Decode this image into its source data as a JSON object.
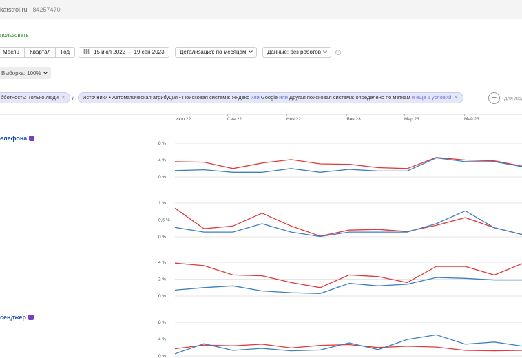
{
  "header": {
    "site_name": "katstroi.ru",
    "counter_id": "84257470"
  },
  "use_link": "пользовать",
  "toolbar": {
    "periods": [
      "Месяц",
      "Квартал",
      "Год"
    ],
    "date_range": "15 июл 2022 — 19 сен 2023",
    "detail": "Детализация: по месяцам",
    "data": "Данные: без роботов",
    "help": "?",
    "sample": "Выборка: 100%"
  },
  "filters": {
    "chip1": "бботность: Только люди",
    "and_label": "и",
    "chip2_prefix": "Источники • Автоматическая атрибуция • Поисковая система: Яндекс",
    "or1": "или",
    "google": "Google",
    "or2": "или",
    "chip2_middle": "Другая поисковая система: определено по меткам",
    "and_more": "и еще 5 условий",
    "add_label": "+",
    "more_text": "для люд"
  },
  "x_axis": [
    "Июл 22",
    "Сен 22",
    "Ноя 22",
    "Янв 23",
    "Мар 23",
    "Май 23"
  ],
  "goals": [
    {
      "name": "елефона",
      "icon": "viber-icon"
    },
    {
      "name": "сенджер",
      "icon": "viber-icon"
    }
  ],
  "colors": {
    "red": "#e23a3a",
    "blue": "#3d7fbf",
    "grid": "#e6e6e6"
  },
  "chart_data": [
    {
      "type": "line",
      "y_ticks": [
        "8 %",
        "4 %",
        "0 %"
      ],
      "ylim": [
        0,
        8
      ],
      "series": [
        {
          "color": "red",
          "values": [
            3.6,
            3.5,
            2.0,
            3.3,
            4.1,
            3.1,
            3.0,
            2.2,
            2.0,
            4.6,
            4.0,
            3.8,
            2.5
          ]
        },
        {
          "color": "blue",
          "values": [
            1.5,
            1.7,
            1.1,
            1.1,
            2.0,
            1.1,
            1.8,
            1.4,
            1.4,
            4.5,
            3.6,
            3.6,
            2.4
          ]
        }
      ]
    },
    {
      "type": "line",
      "y_ticks": [
        "1 %",
        "0,5 %",
        "0 %"
      ],
      "ylim": [
        0,
        1
      ],
      "series": [
        {
          "color": "red",
          "values": [
            0.85,
            0.24,
            0.32,
            0.7,
            0.32,
            0.02,
            0.2,
            0.22,
            0.16,
            0.34,
            0.57,
            0.27,
            0.06
          ]
        },
        {
          "color": "blue",
          "values": [
            0.28,
            0.14,
            0.14,
            0.39,
            0.14,
            0.01,
            0.14,
            0.14,
            0.14,
            0.39,
            0.77,
            0.27,
            0.06
          ]
        }
      ]
    },
    {
      "type": "line",
      "y_ticks": [
        "4 %",
        "2 %",
        "0 %"
      ],
      "ylim": [
        0,
        4
      ],
      "series": [
        {
          "color": "red",
          "values": [
            3.9,
            3.6,
            2.5,
            2.4,
            1.6,
            1.0,
            2.5,
            2.3,
            1.6,
            3.5,
            3.5,
            2.5,
            3.9
          ]
        },
        {
          "color": "blue",
          "values": [
            0.7,
            1.0,
            1.2,
            0.6,
            0.4,
            0.3,
            1.5,
            1.2,
            1.4,
            2.2,
            2.1,
            1.9,
            1.9
          ]
        }
      ]
    },
    {
      "type": "line",
      "y_ticks": [
        "8 %",
        "4 %",
        "0 %"
      ],
      "ylim": [
        0,
        8
      ],
      "series": [
        {
          "color": "red",
          "values": [
            1.7,
            2.6,
            2.4,
            2.8,
            1.9,
            2.5,
            2.7,
            2.0,
            2.3,
            2.1,
            1.3,
            1.2,
            1.3
          ]
        },
        {
          "color": "blue",
          "values": [
            0.5,
            2.9,
            1.3,
            1.8,
            1.2,
            1.4,
            3.1,
            1.5,
            3.9,
            5.0,
            2.8,
            3.3,
            2.3
          ]
        }
      ]
    }
  ]
}
